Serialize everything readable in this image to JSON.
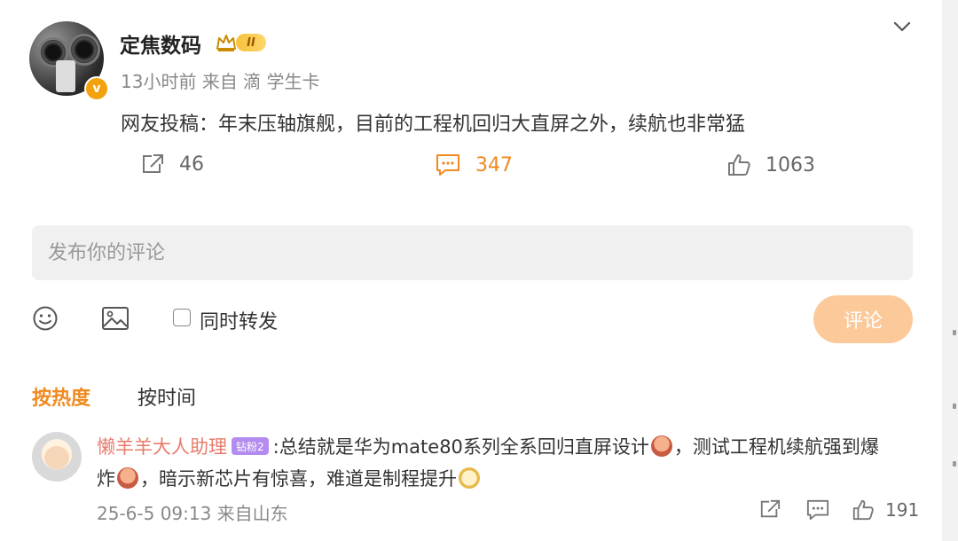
{
  "post": {
    "author": "定焦数码",
    "level_badge": "II",
    "meta": "13小时前 来自 滴 学生卡",
    "text": "网友投稿：年末压轴旗舰，目前的工程机回归大直屏之外，续航也非常猛",
    "repost_count": "46",
    "comment_count": "347",
    "like_count": "1063",
    "verified_badge": "v"
  },
  "composer": {
    "placeholder": "发布你的评论",
    "repost_label": "同时转发",
    "submit_label": "评论"
  },
  "sort_tabs": {
    "hot": "按热度",
    "time": "按时间"
  },
  "reply": {
    "name": "懒羊羊大人助理",
    "fan_badge": "钻粉2",
    "text_part1": ":总结就是华为mate80系列全系回归直屏设计",
    "text_part2": "，测试工程机续航强到爆",
    "text_part3": "炸",
    "text_part4": "，暗示新芯片有惊喜，难道是制程提升",
    "meta": "25-6-5 09:13 来自山东",
    "like_count": "191"
  },
  "colors": {
    "accent": "#f08a20",
    "submit_bg": "#fcc99a",
    "name": "#e87b6b"
  },
  "icons": [
    "chevron-down-icon",
    "share-icon",
    "comment-icon",
    "like-icon",
    "emoji-icon",
    "image-icon",
    "crown-icon"
  ]
}
